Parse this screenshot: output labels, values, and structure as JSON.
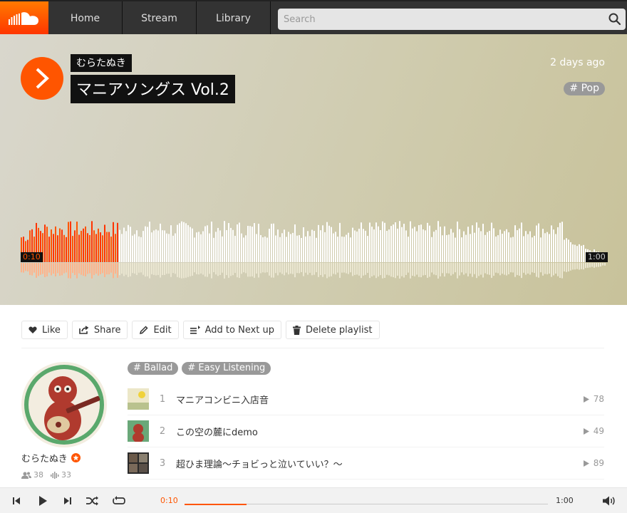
{
  "header": {
    "logo_icon": "soundcloud-cloud-icon",
    "nav": [
      {
        "label": "Home"
      },
      {
        "label": "Stream"
      },
      {
        "label": "Library"
      }
    ],
    "search": {
      "placeholder": "Search",
      "value": ""
    }
  },
  "hero": {
    "artist": "むらたぬき",
    "title": "マニアソングス Vol.2",
    "posted": "2 days ago",
    "genre": "Pop",
    "current_time": "0:10",
    "duration": "1:00",
    "progress": 0.167,
    "accent": "#ff5500"
  },
  "actions": [
    {
      "label": "Like",
      "icon": "heart-icon"
    },
    {
      "label": "Share",
      "icon": "share-icon"
    },
    {
      "label": "Edit",
      "icon": "pencil-icon"
    },
    {
      "label": "Add to Next up",
      "icon": "next-up-icon"
    },
    {
      "label": "Delete playlist",
      "icon": "trash-icon"
    }
  ],
  "user": {
    "name": "むらたぬき",
    "followers": "38",
    "tracks": "33"
  },
  "tags": [
    "Ballad",
    "Easy Listening"
  ],
  "tracks": [
    {
      "num": "1",
      "title": "マニアコンビニ入店音",
      "plays": "78"
    },
    {
      "num": "2",
      "title": "この空の麓にdemo",
      "plays": "49"
    },
    {
      "num": "3",
      "title": "超ひま理論〜チョビっと泣いていい？〜",
      "plays": "89"
    }
  ],
  "player": {
    "current_time": "0:10",
    "duration": "1:00",
    "progress": 0.17
  }
}
